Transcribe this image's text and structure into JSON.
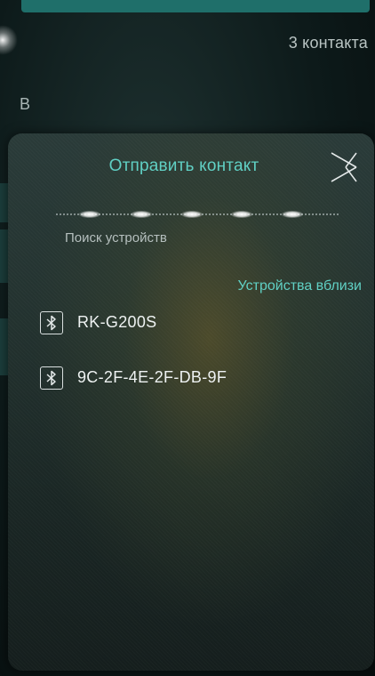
{
  "background": {
    "contact_count": "3 контакта",
    "section_letter": "В"
  },
  "dialog": {
    "title": "Отправить контакт",
    "close_icon": "close-icon",
    "scan_status": "Поиск устройств",
    "nearby_header": "Устройства вблизи",
    "devices": [
      {
        "name": "RK-G200S",
        "icon": "bluetooth-icon"
      },
      {
        "name": "9C-2F-4E-2F-DB-9F",
        "icon": "bluetooth-icon"
      }
    ]
  },
  "colors": {
    "accent": "#5fd0c4",
    "text_primary": "#eef2f2",
    "text_secondary": "#b5bfbe"
  }
}
